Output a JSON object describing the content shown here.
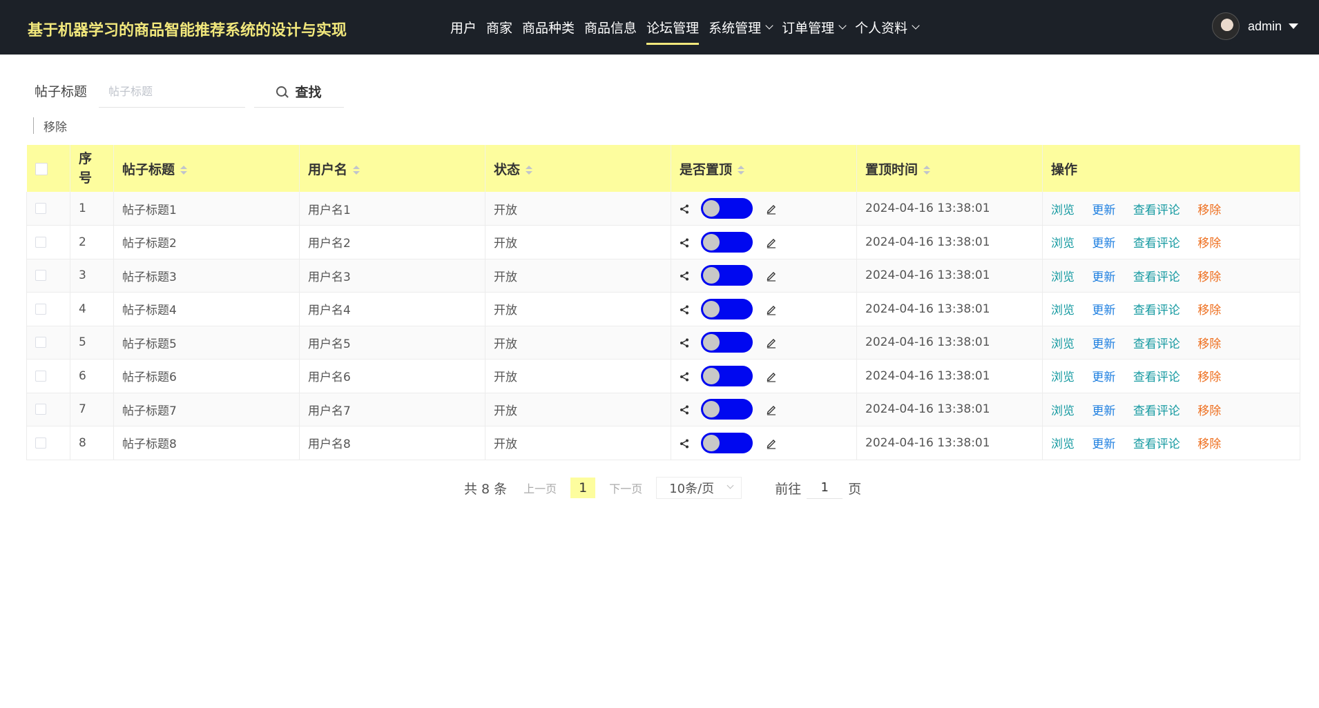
{
  "header": {
    "app_title": "基于机器学习的商品智能推荐系统的设计与实现",
    "nav": [
      {
        "label": "用户",
        "has_dropdown": false,
        "active": false
      },
      {
        "label": "商家",
        "has_dropdown": false,
        "active": false
      },
      {
        "label": "商品种类",
        "has_dropdown": false,
        "active": false
      },
      {
        "label": "商品信息",
        "has_dropdown": false,
        "active": false
      },
      {
        "label": "论坛管理",
        "has_dropdown": false,
        "active": true
      },
      {
        "label": "系统管理",
        "has_dropdown": true,
        "active": false
      },
      {
        "label": "订单管理",
        "has_dropdown": true,
        "active": false
      },
      {
        "label": "个人资料",
        "has_dropdown": true,
        "active": false
      }
    ],
    "username": "admin"
  },
  "search": {
    "label": "帖子标题",
    "placeholder": "帖子标题",
    "value": "",
    "button_label": "查找"
  },
  "toolbar": {
    "remove_label": "移除"
  },
  "table": {
    "columns": [
      "序号",
      "帖子标题",
      "用户名",
      "状态",
      "是否置顶",
      "置顶时间",
      "操作"
    ],
    "actions": {
      "view": "浏览",
      "update": "更新",
      "comments": "查看评论",
      "remove": "移除"
    },
    "rows": [
      {
        "index": "1",
        "title": "帖子标题1",
        "username": "用户名1",
        "status": "开放",
        "pinned_time": "2024-04-16 13:38:01"
      },
      {
        "index": "2",
        "title": "帖子标题2",
        "username": "用户名2",
        "status": "开放",
        "pinned_time": "2024-04-16 13:38:01"
      },
      {
        "index": "3",
        "title": "帖子标题3",
        "username": "用户名3",
        "status": "开放",
        "pinned_time": "2024-04-16 13:38:01"
      },
      {
        "index": "4",
        "title": "帖子标题4",
        "username": "用户名4",
        "status": "开放",
        "pinned_time": "2024-04-16 13:38:01"
      },
      {
        "index": "5",
        "title": "帖子标题5",
        "username": "用户名5",
        "status": "开放",
        "pinned_time": "2024-04-16 13:38:01"
      },
      {
        "index": "6",
        "title": "帖子标题6",
        "username": "用户名6",
        "status": "开放",
        "pinned_time": "2024-04-16 13:38:01"
      },
      {
        "index": "7",
        "title": "帖子标题7",
        "username": "用户名7",
        "status": "开放",
        "pinned_time": "2024-04-16 13:38:01"
      },
      {
        "index": "8",
        "title": "帖子标题8",
        "username": "用户名8",
        "status": "开放",
        "pinned_time": "2024-04-16 13:38:01"
      }
    ]
  },
  "pagination": {
    "total_text": "共 8 条",
    "prev_label": "上一页",
    "current_page": "1",
    "next_label": "下一页",
    "page_size": "10条/页",
    "goto_label": "前往",
    "goto_value": "1",
    "goto_suffix": "页"
  },
  "colors": {
    "header_bg": "#1c2128",
    "title_color": "#f2e87c",
    "table_header_bg": "#fdfd9e",
    "switch_color": "#0008f0",
    "view_link": "#169aa1",
    "update_link": "#1e7fe0",
    "remove_link": "#ee6f1f"
  },
  "icons": [
    "search-icon",
    "share-icon",
    "edit-icon",
    "chevron-down-icon",
    "caret-down-icon",
    "sort-icon"
  ]
}
